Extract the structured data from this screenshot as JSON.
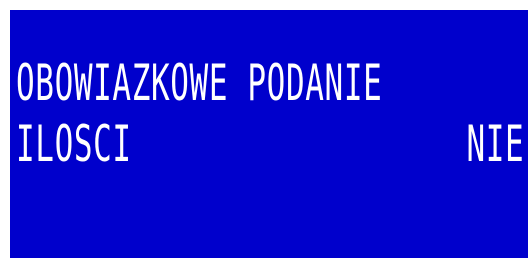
{
  "display": {
    "line1": "OBOWIAZKOWE PODANIE",
    "line2_label": "ILOSCI",
    "line2_value": "NIE"
  },
  "colors": {
    "screen_background": "#0000cc",
    "text": "#ffffff",
    "page_background": "#ffffff"
  }
}
